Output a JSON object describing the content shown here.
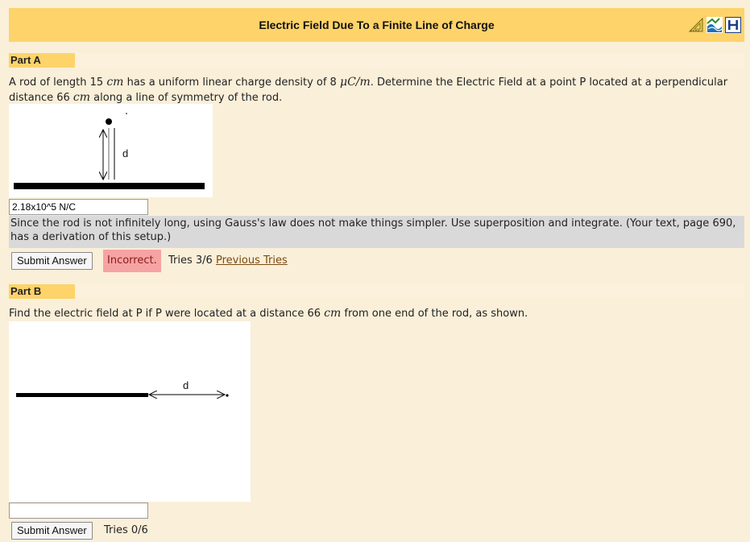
{
  "header": {
    "title": "Electric Field Due To a Finite Line of Charge",
    "icons": [
      "ruler-triangle-icon",
      "feedback-icon",
      "hint-h-icon"
    ]
  },
  "part_a": {
    "label": "Part A",
    "question": {
      "t1": "A rod of length 15 ",
      "u1": "cm",
      "t2": " has a uniform linear charge density of 8 ",
      "u2": "μC/m",
      "t3": ". Determine the Electric Field at a point P located at a perpendicular distance 66 ",
      "u3": "cm",
      "t4": " along a line of symmetry of the rod."
    },
    "figure_label": "d",
    "answer_value": "2.18x10^5 N/C",
    "hint": "Since the rod is not infinitely long, using Gauss's law does not make things simpler. Use superposition and integrate. (Your text, page 690, has a derivation of this setup.)",
    "submit_label": "Submit Answer",
    "status": "Incorrect.",
    "tries": "Tries 3/6",
    "previous_tries": "Previous Tries"
  },
  "part_b": {
    "label": "Part B",
    "question": {
      "t1": "Find the electric field at P if P were located at a distance 66 ",
      "u1": "cm",
      "t2": " from one end of the rod, as shown."
    },
    "figure_label": "d",
    "answer_value": "",
    "submit_label": "Submit Answer",
    "tries": "Tries 0/6"
  }
}
